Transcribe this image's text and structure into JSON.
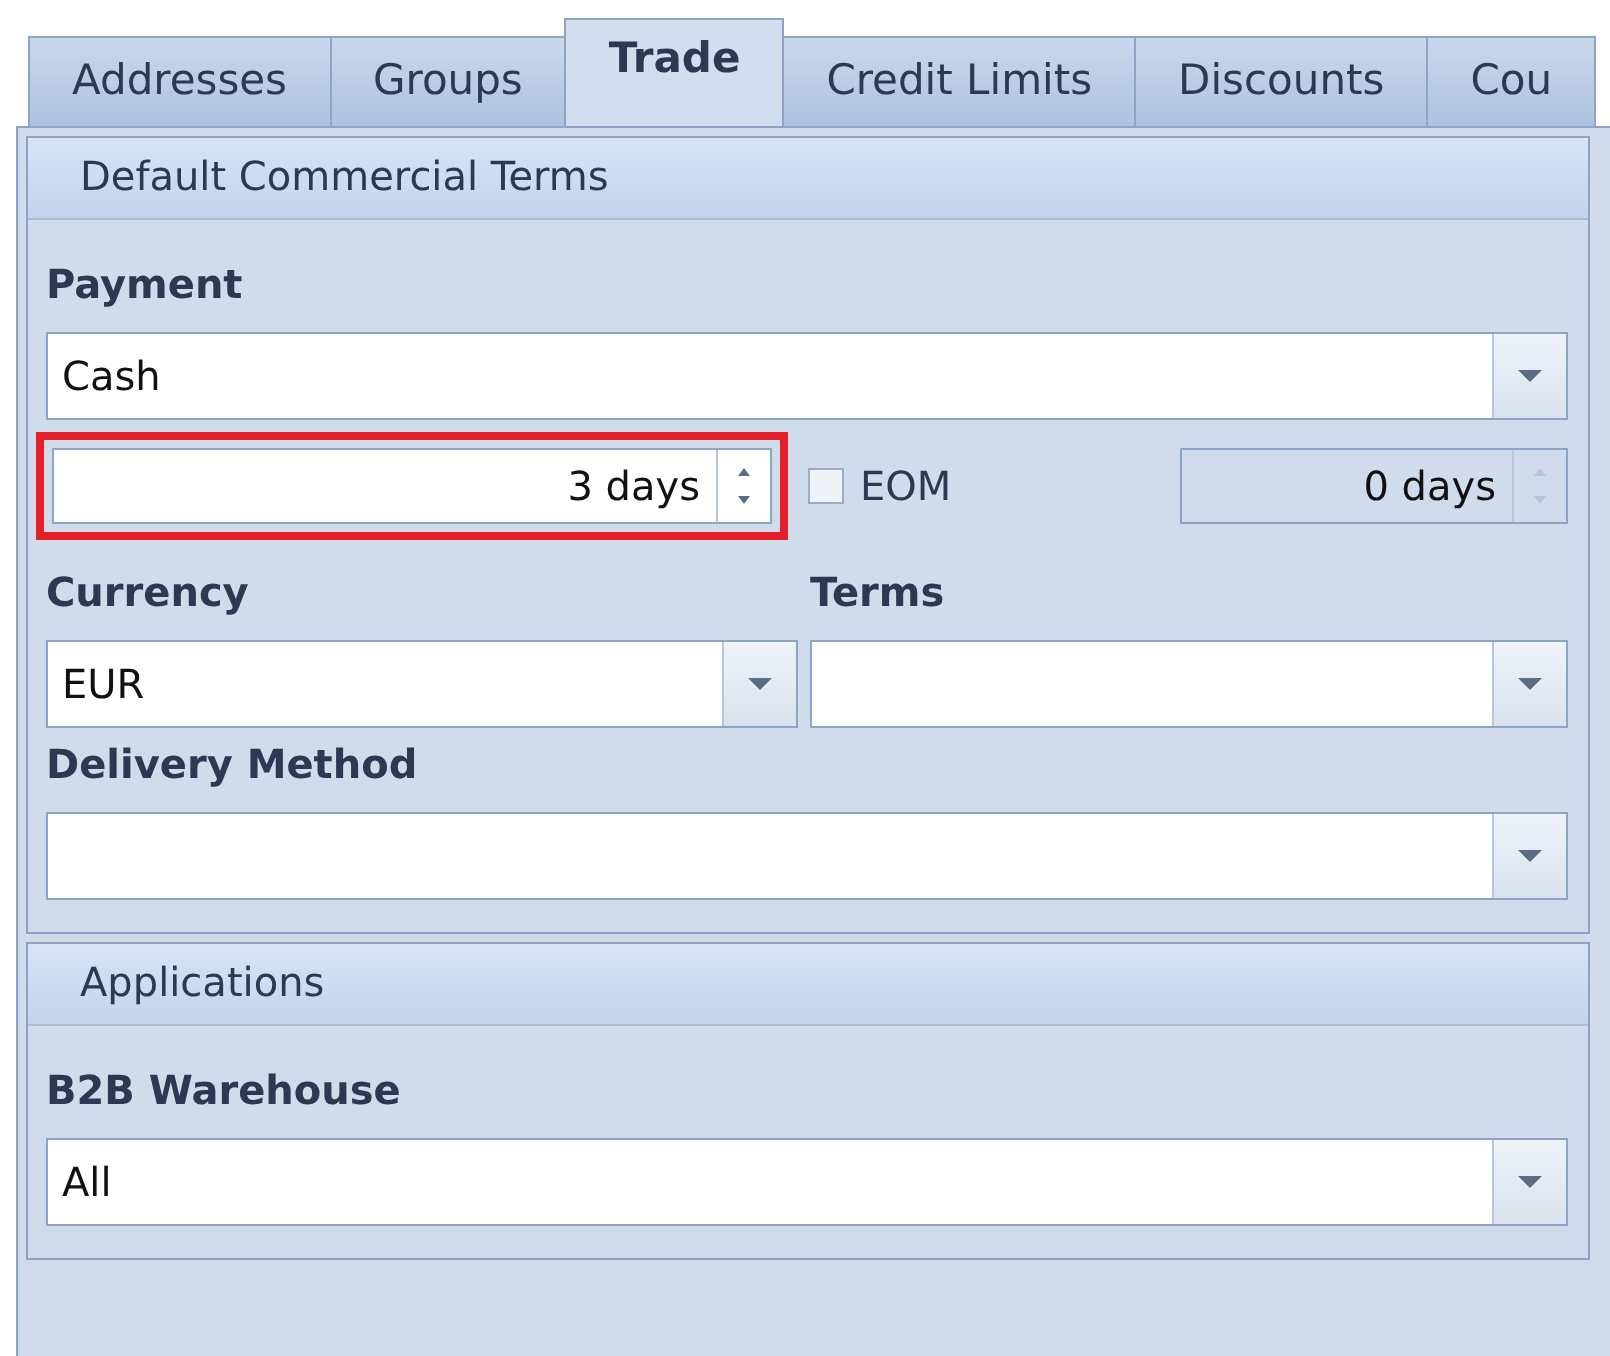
{
  "tabs": [
    {
      "label": "Addresses",
      "selected": false
    },
    {
      "label": "Groups",
      "selected": false
    },
    {
      "label": "Trade",
      "selected": true
    },
    {
      "label": "Credit Limits",
      "selected": false
    },
    {
      "label": "Discounts",
      "selected": false
    },
    {
      "label": "Cou",
      "selected": false
    }
  ],
  "default_terms": {
    "title": "Default Commercial Terms",
    "payment": {
      "label": "Payment",
      "value": "Cash"
    },
    "due": {
      "value": "3 days",
      "highlighted": true,
      "disabled": false
    },
    "eom": {
      "label": "EOM",
      "checked": false
    },
    "grace": {
      "value": "0 days",
      "disabled": true
    },
    "currency": {
      "label": "Currency",
      "value": "EUR"
    },
    "terms": {
      "label": "Terms"
    },
    "delivery_method": {
      "label": "Delivery Method"
    }
  },
  "applications": {
    "title": "Applications",
    "b2b_warehouse": {
      "label": "B2B Warehouse",
      "value": "All"
    }
  }
}
